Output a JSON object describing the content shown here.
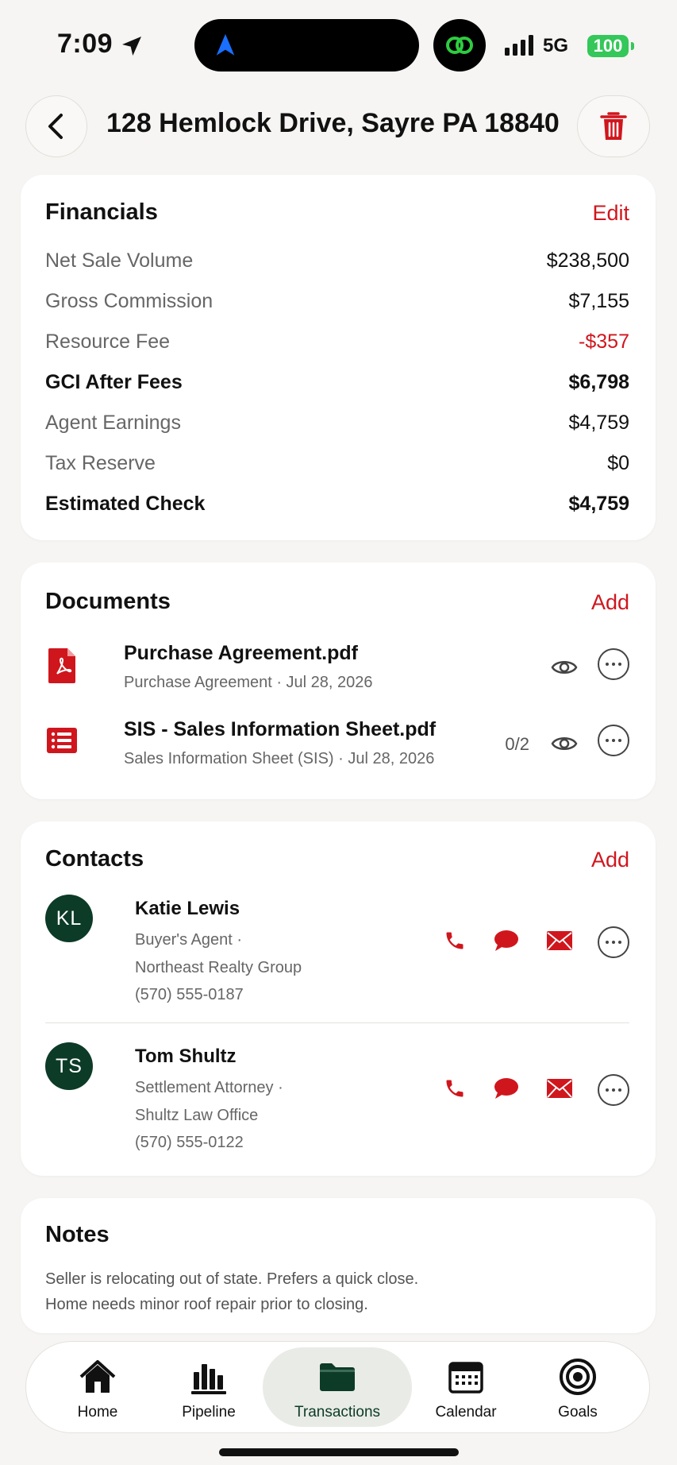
{
  "status_bar": {
    "time": "7:09",
    "network": "5G",
    "battery": "100"
  },
  "header": {
    "title": "128 Hemlock Drive, Sayre PA 18840"
  },
  "financials": {
    "title": "Financials",
    "action": "Edit",
    "rows": [
      {
        "label": "Net Sale Volume",
        "value": "$238,500",
        "bold": false
      },
      {
        "label": "Gross Commission",
        "value": "$7,155",
        "bold": false
      },
      {
        "label": "Resource Fee",
        "value": "-$357",
        "bold": false,
        "negative": true
      },
      {
        "label": "GCI After Fees",
        "value": "$6,798",
        "bold": true
      },
      {
        "label": "Agent Earnings",
        "value": "$4,759",
        "bold": false
      },
      {
        "label": "Tax Reserve",
        "value": "$0",
        "bold": false
      },
      {
        "label": "Estimated Check",
        "value": "$4,759",
        "bold": true
      }
    ]
  },
  "documents": {
    "title": "Documents",
    "action": "Add",
    "items": [
      {
        "name": "Purchase Agreement.pdf",
        "subtitle": "Purchase Agreement · Jul 28, 2026",
        "count": "",
        "icon": "pdf-file-icon"
      },
      {
        "name": "SIS - Sales Information Sheet.pdf",
        "subtitle": "Sales Information Sheet (SIS) · Jul 28, 2026",
        "count": "0/2",
        "icon": "list-form-icon"
      }
    ]
  },
  "contacts": {
    "title": "Contacts",
    "action": "Add",
    "items": [
      {
        "initials": "KL",
        "name": "Katie Lewis",
        "role": "Buyer's Agent ·",
        "company": "Northeast Realty Group",
        "phone": "(570) 555-0187"
      },
      {
        "initials": "TS",
        "name": "Tom Shultz",
        "role": "Settlement Attorney ·",
        "company": "Shultz Law Office",
        "phone": "(570) 555-0122"
      }
    ]
  },
  "notes": {
    "title": "Notes",
    "lines": [
      "Seller is relocating out of state. Prefers a quick close.",
      "Home needs minor roof repair prior to closing."
    ]
  },
  "tabbar": {
    "tabs": [
      {
        "label": "Home",
        "icon": "home-icon"
      },
      {
        "label": "Pipeline",
        "icon": "bar-chart-icon"
      },
      {
        "label": "Transactions",
        "icon": "folder-icon",
        "active": true
      },
      {
        "label": "Calendar",
        "icon": "calendar-icon"
      },
      {
        "label": "Goals",
        "icon": "target-icon"
      }
    ]
  },
  "colors": {
    "accent": "#d0161d",
    "brand_green": "#0c3b27",
    "battery": "#34c759"
  }
}
